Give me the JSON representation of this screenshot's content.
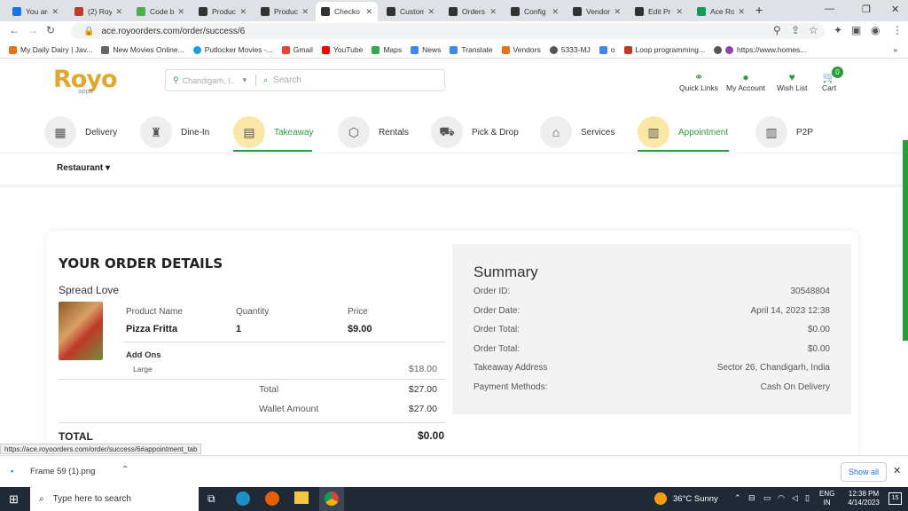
{
  "browser": {
    "tabs": [
      "You are",
      "(2) Roy",
      "Code b",
      "Product",
      "Product",
      "Checko",
      "Custom",
      "Orders",
      "Config",
      "Vendor",
      "Edit Pr",
      "Ace Ro"
    ],
    "active_tab": 5,
    "url": "ace.royoorders.com/order/success/6",
    "bookmarks": [
      "My Daily Dairy | Jav...",
      "New Movies Online...",
      "Putlocker Movies -...",
      "Gmail",
      "YouTube",
      "Maps",
      "News",
      "Translate",
      "Vendors",
      "5333-MJ",
      "o",
      "Loop programming...",
      "https://www.homes..."
    ],
    "status_link": "https://ace.royoorders.com/order/success/6#appointment_tab"
  },
  "site": {
    "logo": "Royo",
    "logo_sub": "apps",
    "location": "Chandigarh, I...",
    "search_placeholder": "Search",
    "header_links": [
      "Quick Links",
      "My Account",
      "Wish List",
      "Cart"
    ],
    "cart_count": "0",
    "categories": [
      {
        "label": "Delivery",
        "highlight": false
      },
      {
        "label": "Dine-In",
        "highlight": false
      },
      {
        "label": "Takeaway",
        "highlight": true
      },
      {
        "label": "Rentals",
        "highlight": false
      },
      {
        "label": "Pick & Drop",
        "highlight": false
      },
      {
        "label": "Services",
        "highlight": false
      },
      {
        "label": "Appointment",
        "highlight": true
      },
      {
        "label": "P2P",
        "highlight": false
      }
    ],
    "subnav": "Restaurant"
  },
  "order": {
    "title": "YOUR ORDER DETAILS",
    "vendor": "Spread Love",
    "col_product": "Product Name",
    "col_qty": "Quantity",
    "col_price": "Price",
    "product": "Pizza Fritta",
    "qty": "1",
    "price": "$9.00",
    "addons_label": "Add Ons",
    "addon_name": "Large",
    "addon_price": "$18.00",
    "total_label": "Total",
    "total_value": "$27.00",
    "wallet_label": "Wallet Amount",
    "wallet_value": "$27.00",
    "grand_label": "TOTAL",
    "grand_value": "$0.00"
  },
  "summary": {
    "title": "Summary",
    "rows": [
      {
        "k": "Order ID:",
        "v": "30548804"
      },
      {
        "k": "Order Date:",
        "v": "April 14, 2023 12:38"
      },
      {
        "k": "Order Total:",
        "v": "$0.00"
      },
      {
        "k": "Order Total:",
        "v": "$0.00"
      },
      {
        "k": "Takeaway Address",
        "v": "Sector 26, Chandigarh, India"
      },
      {
        "k": "Payment Methods:",
        "v": "Cash On Delivery"
      }
    ]
  },
  "downloads": {
    "file": "Frame 59 (1).png",
    "show_all": "Show all"
  },
  "taskbar": {
    "search": "Type here to search",
    "weather": "36°C  Sunny",
    "lang1": "ENG",
    "lang2": "IN",
    "time": "12:38 PM",
    "date": "4/14/2023",
    "notif": "15"
  }
}
